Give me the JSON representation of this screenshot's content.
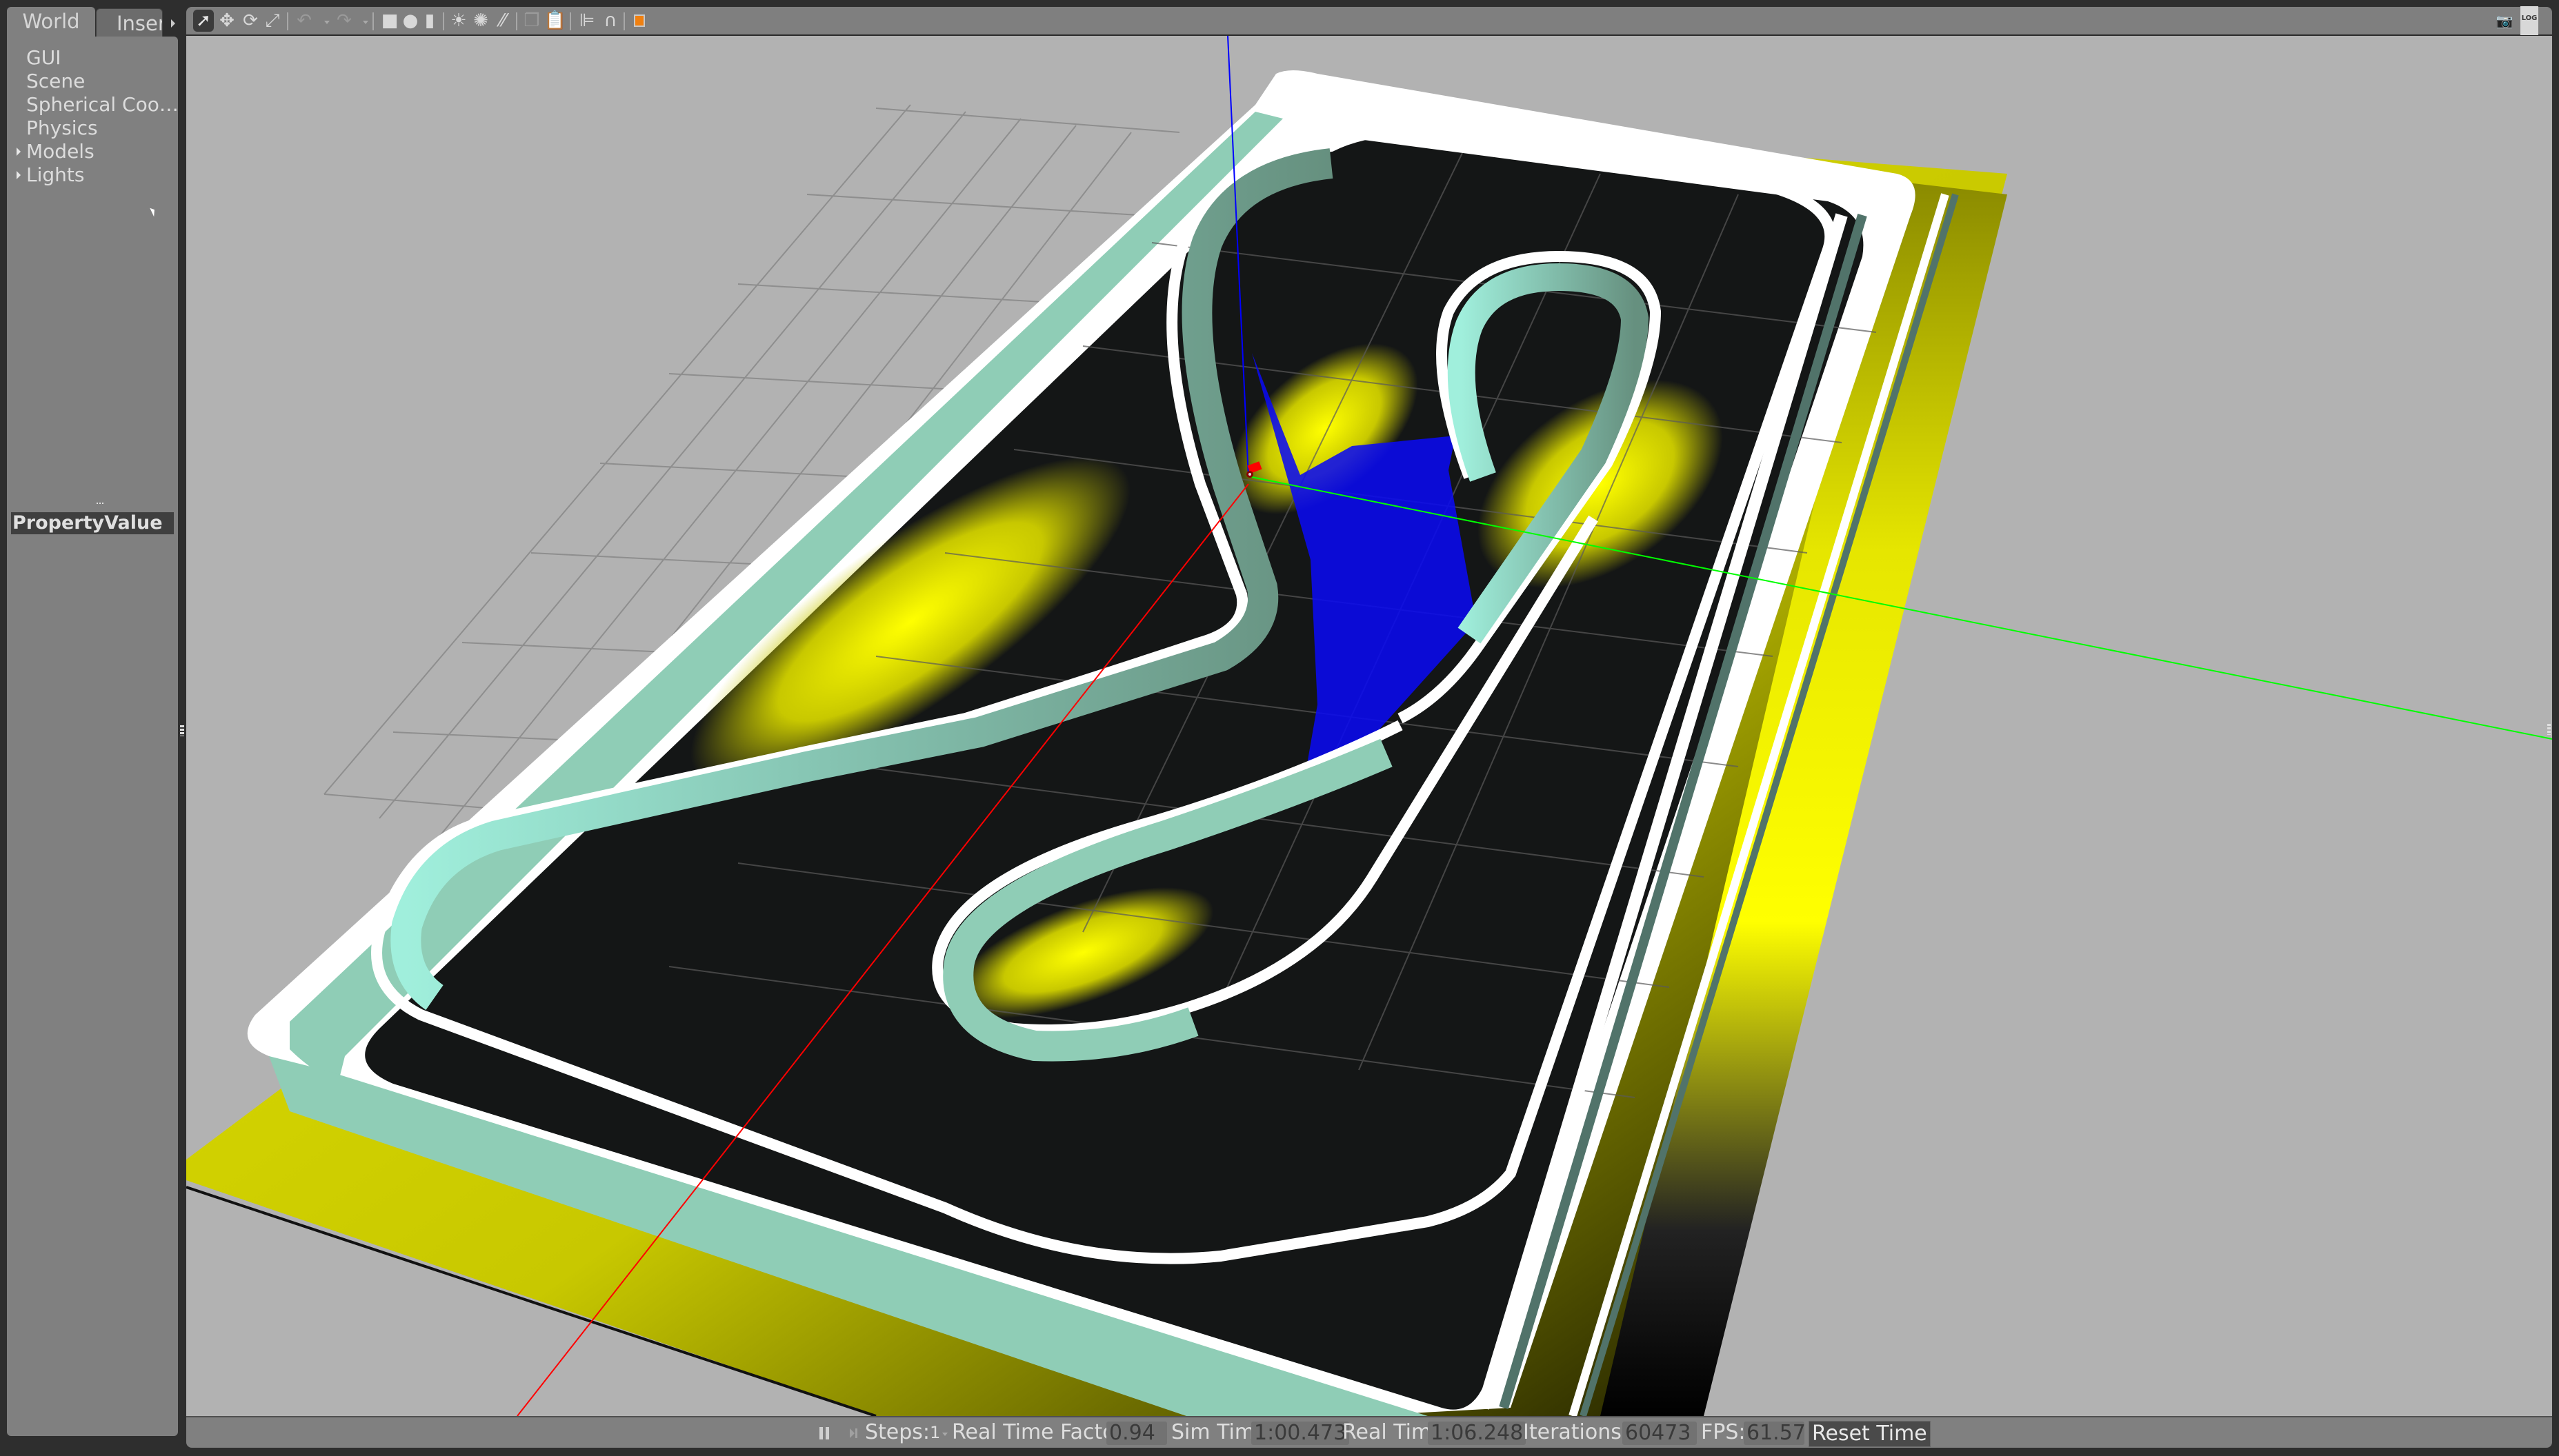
{
  "left_panel": {
    "tabs": [
      {
        "label": "World",
        "active": true
      },
      {
        "label": "Insert",
        "active": false
      }
    ],
    "tree": [
      {
        "label": "GUI",
        "expandable": false
      },
      {
        "label": "Scene",
        "expandable": false
      },
      {
        "label": "Spherical Coo…",
        "expandable": false
      },
      {
        "label": "Physics",
        "expandable": false
      },
      {
        "label": "Models",
        "expandable": true
      },
      {
        "label": "Lights",
        "expandable": true
      }
    ],
    "property_table": {
      "columns": [
        "Property",
        "Value"
      ]
    }
  },
  "toolbar": {
    "tools": [
      {
        "name": "select-mode",
        "glyph": "➚",
        "active": true
      },
      {
        "name": "translate-mode",
        "glyph": "✥"
      },
      {
        "name": "rotate-mode",
        "glyph": "⟳"
      },
      {
        "name": "scale-mode",
        "glyph": "⤢"
      },
      {
        "name": "undo",
        "glyph": "↶",
        "disabled": true
      },
      {
        "name": "redo",
        "glyph": "↷",
        "disabled": true
      },
      {
        "name": "box-shape",
        "glyph": "■"
      },
      {
        "name": "sphere-shape",
        "glyph": "●"
      },
      {
        "name": "cylinder-shape",
        "glyph": "▮"
      },
      {
        "name": "point-light",
        "glyph": "☀"
      },
      {
        "name": "spot-light",
        "glyph": "✺"
      },
      {
        "name": "directional-light",
        "glyph": "⁄⁄"
      },
      {
        "name": "copy",
        "glyph": "❐",
        "disabled": true
      },
      {
        "name": "paste",
        "glyph": "📋",
        "disabled": true
      },
      {
        "name": "align",
        "glyph": "⊫"
      },
      {
        "name": "snap",
        "glyph": "∩"
      },
      {
        "name": "change-view",
        "glyph": "▣"
      }
    ],
    "right_tools": [
      {
        "name": "screenshot",
        "glyph": "📷"
      },
      {
        "name": "log",
        "glyph": "LOG"
      }
    ],
    "accent_color": "#f08010"
  },
  "statusbar": {
    "steps_label": "Steps:",
    "steps_value": "1",
    "rtf_label": "Real Time Factor:",
    "rtf_value": "0.94",
    "sim_time_label": "Sim Time:",
    "sim_time_value": "1:00.473",
    "real_time_label": "Real Time:",
    "real_time_value": "1:06.248",
    "iterations_label": "Iterations:",
    "iterations_value": "60473",
    "fps_label": "FPS:",
    "fps_value": "61.57",
    "reset_label": "Reset Time"
  },
  "scene": {
    "background": "#b2b2b2",
    "track_wall_color": "#8fcdb6",
    "track_top_color": "#ffffff",
    "track_floor_color": "#131515",
    "highlight_color": "#ffff00",
    "laser_color": "#0000ff",
    "axis_colors": {
      "x": "#ff0000",
      "y": "#00ff00",
      "z": "#0000ff"
    }
  }
}
